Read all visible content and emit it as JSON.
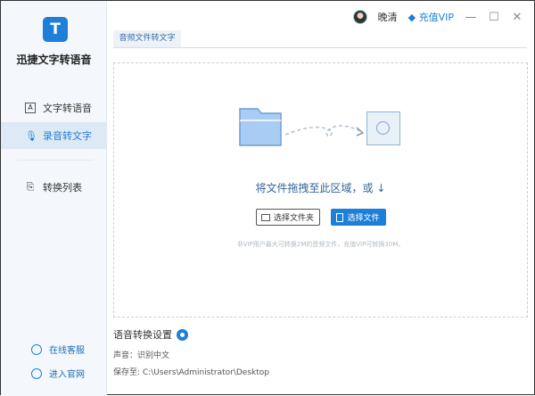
{
  "app": {
    "name": "迅捷文字转语音",
    "logo_letter": "T"
  },
  "sidebar": {
    "items": [
      {
        "label": "文字转语音",
        "icon": "A"
      },
      {
        "label": "录音转文字",
        "icon": "🎙"
      },
      {
        "label": "转换列表",
        "icon": "⎘"
      }
    ],
    "footer": [
      {
        "label": "在线客服"
      },
      {
        "label": "进入官网"
      }
    ]
  },
  "topbar": {
    "user": "晚清",
    "vip": "充值VIP",
    "vip_icon": "◆",
    "minimize": "—",
    "maximize": "☐",
    "close": "✕"
  },
  "tab": {
    "label": "音频文件转文字"
  },
  "drop": {
    "hint": "将文件拖拽至此区域，或",
    "hint_arrow": "↓",
    "select_folder": "选择文件夹",
    "select_file": "选择文件",
    "note": "非VIP用户最大可转换2M的音频文件，充值VIP可转换30M。"
  },
  "settings": {
    "title": "语音转换设置",
    "voice": "声音：识别中文",
    "save_to": "保存至: C:\\Users\\Administrator\\Desktop"
  }
}
